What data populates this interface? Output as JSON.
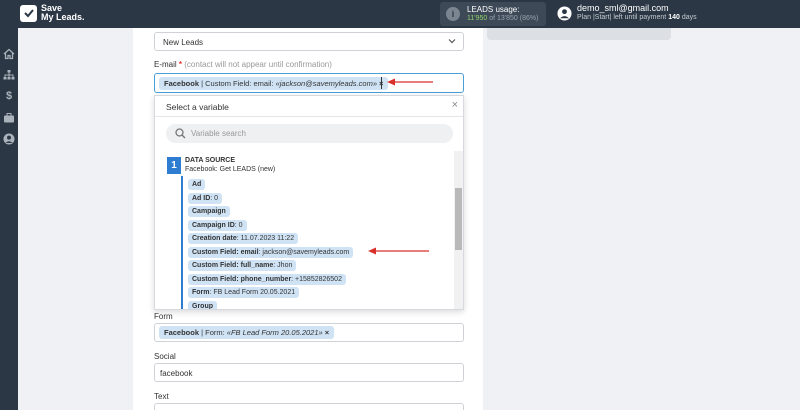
{
  "topbar": {
    "logo_line1": "Save",
    "logo_line2": "My Leads.",
    "leads_title": "LEADS usage:",
    "leads_used": "11'950",
    "leads_rest": " of 13'850 ",
    "leads_percent": "(86%)",
    "user_email": "demo_sml@gmail.com",
    "plan_prefix": "Plan |Start| left until payment ",
    "plan_days": "140",
    "plan_suffix": " days"
  },
  "sidebar": {
    "icons": [
      "home-icon",
      "sitemap-icon",
      "dollar-icon",
      "briefcase-icon",
      "user-circle-icon"
    ]
  },
  "form": {
    "top_select_value": "New Leads",
    "email_label": "E-mail",
    "email_required": "*",
    "email_hint": "(contact will not appear until confirmation)",
    "email_tag": {
      "source": "Facebook",
      "rest": " | Custom Field: email: ",
      "value": "«jackson@savemyleads.com»",
      "remove": "×"
    },
    "form_label": "Form",
    "form_tag": {
      "source": "Facebook",
      "rest": " | Form: ",
      "value": "«FB Lead Form 20.05.2021»",
      "remove": "×"
    },
    "social_label": "Social",
    "social_value": "facebook",
    "text_label": "Text"
  },
  "variable_panel": {
    "header": "Select a variable",
    "close": "×",
    "search_placeholder": "Variable search",
    "source_number": "1",
    "source_title": "DATA SOURCE",
    "source_subtitle": "Facebook: Get LEADS (new)",
    "items": [
      {
        "name": "Ad",
        "value": ""
      },
      {
        "name": "Ad ID",
        "value": ": 0"
      },
      {
        "name": "Campaign",
        "value": ""
      },
      {
        "name": "Campaign ID",
        "value": ": 0"
      },
      {
        "name": "Creation date",
        "value": ": 11.07.2023 11:22"
      },
      {
        "name": "Custom Field: email",
        "value": ": jackson@savemyleads.com"
      },
      {
        "name": "Custom Field: full_name",
        "value": ": Jhon"
      },
      {
        "name": "Custom Field: phone_number",
        "value": ": +15852826502"
      },
      {
        "name": "Form",
        "value": ": FB Lead Form 20.05.2021"
      },
      {
        "name": "Group",
        "value": ""
      }
    ]
  },
  "colors": {
    "accent": "#2e7dd1",
    "tag_bg": "#cfe3f5",
    "arrow": "#d9302c",
    "topbar": "#2b3745"
  }
}
